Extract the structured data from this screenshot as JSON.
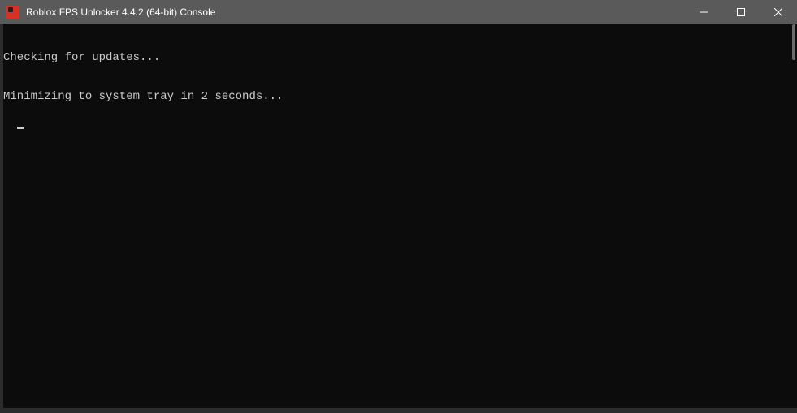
{
  "titlebar": {
    "title": "Roblox FPS Unlocker 4.4.2 (64-bit) Console"
  },
  "console": {
    "lines": [
      "Checking for updates...",
      "Minimizing to system tray in 2 seconds..."
    ]
  }
}
